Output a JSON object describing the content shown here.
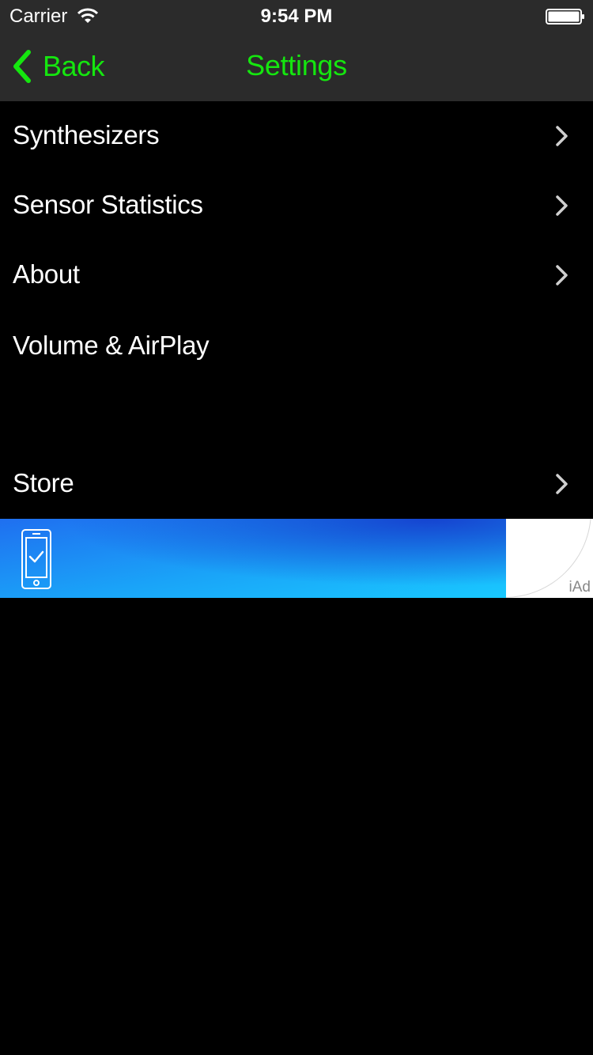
{
  "status_bar": {
    "carrier": "Carrier",
    "time": "9:54 PM"
  },
  "nav": {
    "back_label": "Back",
    "title": "Settings",
    "accent_color": "#15e60f"
  },
  "rows": [
    {
      "label": "Synthesizers",
      "has_chevron": true
    },
    {
      "label": "Sensor Statistics",
      "has_chevron": true
    },
    {
      "label": "About",
      "has_chevron": true
    },
    {
      "label": "Volume & AirPlay",
      "has_chevron": false
    },
    {
      "label": "Store",
      "has_chevron": true
    }
  ],
  "ad": {
    "badge": "iAd",
    "icon": "phone-check-icon"
  }
}
